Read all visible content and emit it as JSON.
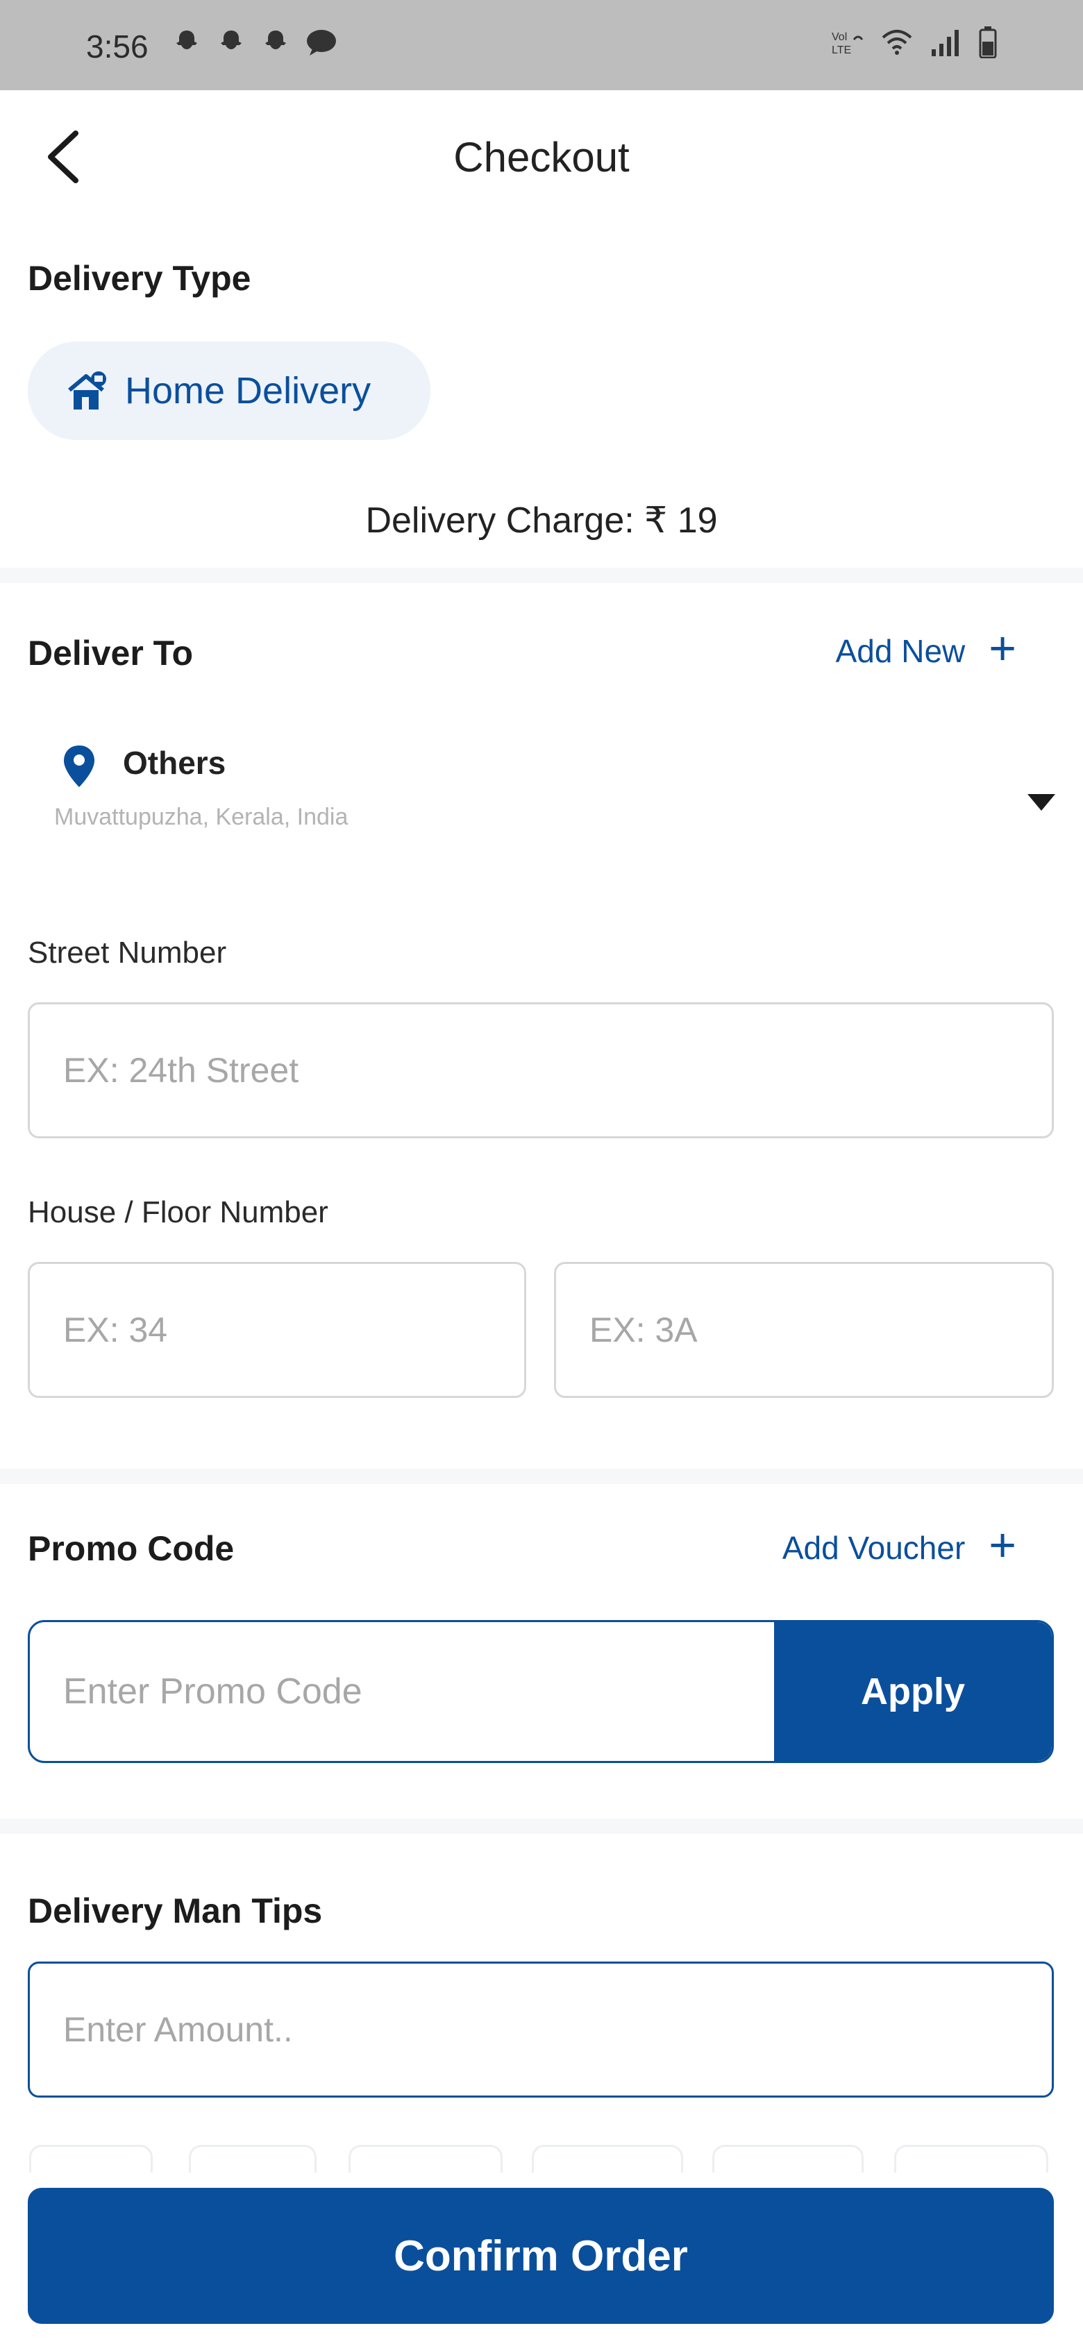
{
  "status_bar": {
    "time": "3:56",
    "notification_icons": [
      "snapchat-icon",
      "snapchat-icon",
      "snapchat-icon",
      "chat-icon"
    ],
    "right_icons": [
      "volte-icon",
      "wifi-icon",
      "signal-icon",
      "battery-icon"
    ]
  },
  "header": {
    "title": "Checkout"
  },
  "delivery_type": {
    "title": "Delivery Type",
    "option_label": "Home Delivery",
    "charge_text": "Delivery Charge: ₹ 19"
  },
  "deliver_to": {
    "title": "Deliver To",
    "add_new_label": "Add New",
    "address_label": "Others",
    "address_line": "Muvattupuzha, Kerala, India"
  },
  "street": {
    "label": "Street Number",
    "placeholder": "EX: 24th Street"
  },
  "house": {
    "label": "House / Floor Number",
    "house_placeholder": "EX: 34",
    "floor_placeholder": "EX: 3A"
  },
  "promo": {
    "title": "Promo Code",
    "add_voucher_label": "Add Voucher",
    "placeholder": "Enter Promo Code",
    "apply_label": "Apply"
  },
  "tips": {
    "title": "Delivery Man Tips",
    "placeholder": "Enter Amount.."
  },
  "footer": {
    "confirm_label": "Confirm Order"
  },
  "colors": {
    "accent": "#0a4f9c",
    "chip_bg": "#eef3f9",
    "status_bar": "#bdbdbd"
  }
}
